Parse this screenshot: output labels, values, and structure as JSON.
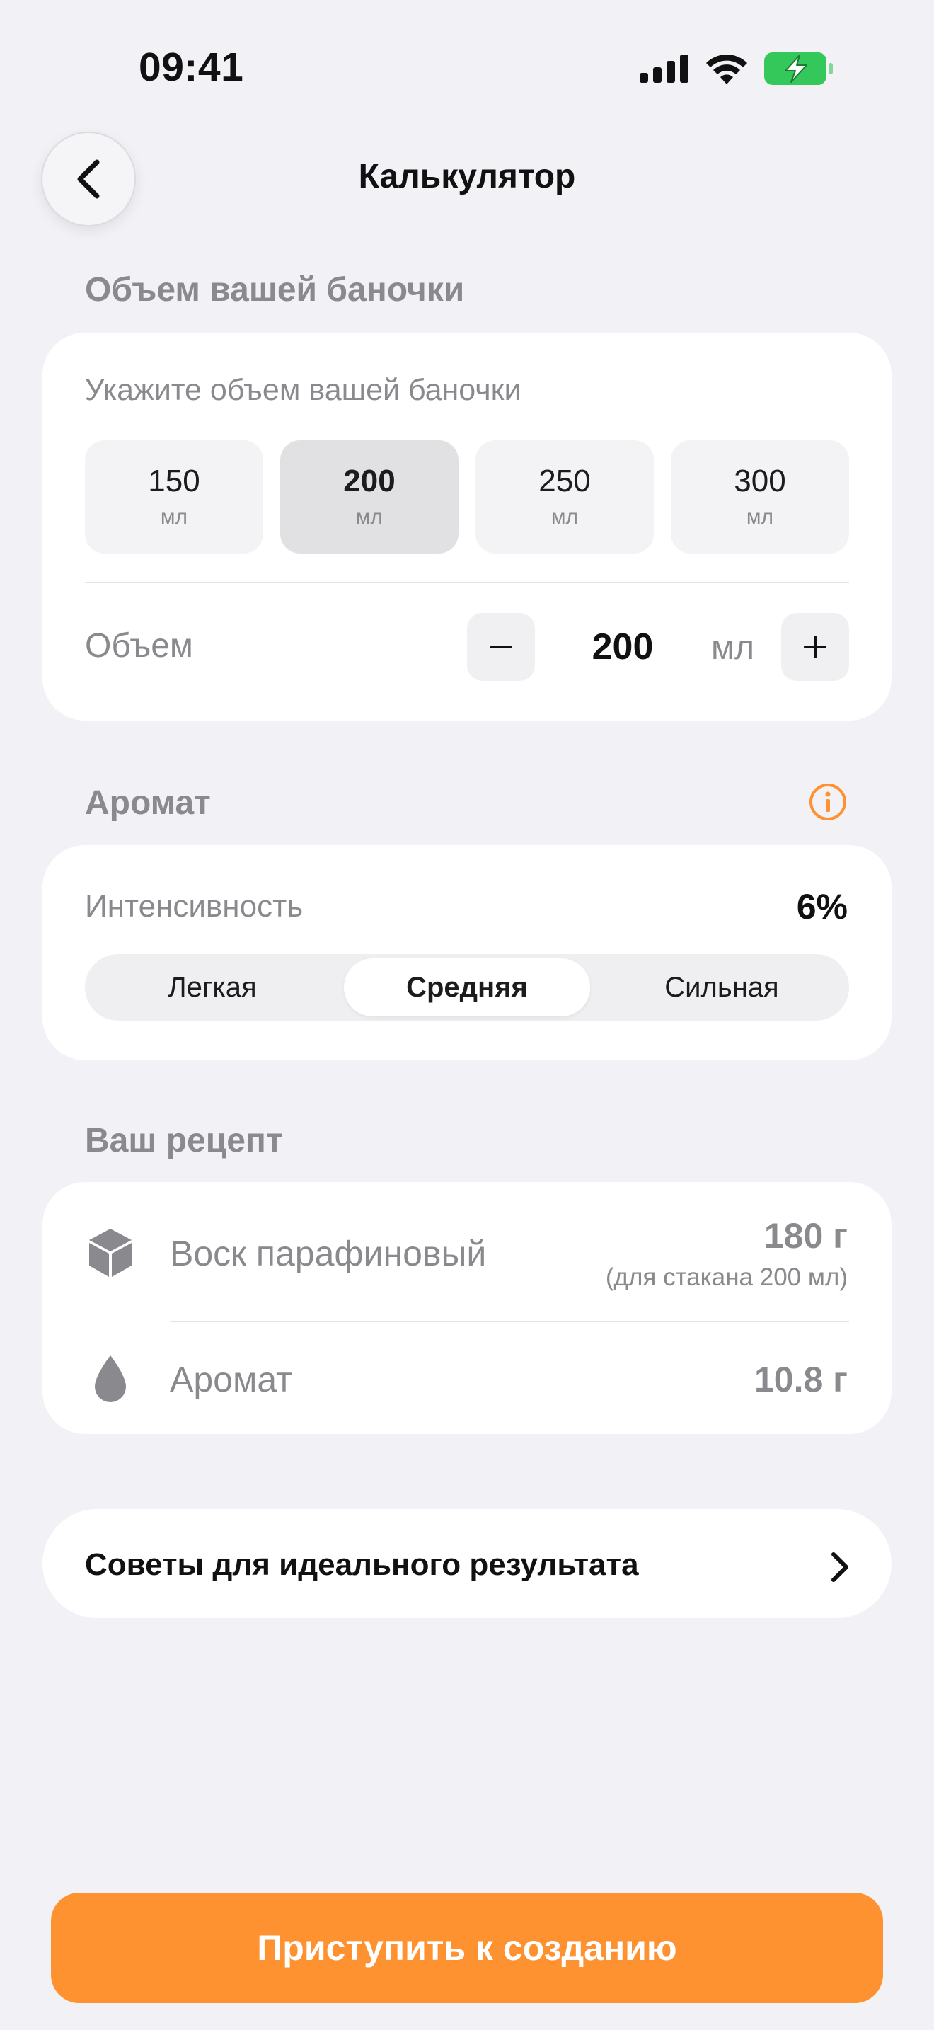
{
  "status_bar": {
    "time": "09:41"
  },
  "header": {
    "title": "Калькулятор",
    "back_icon": "chevron-left-icon"
  },
  "volume_section": {
    "title": "Объем вашей баночки",
    "hint": "Укажите объем вашей баночки",
    "presets": [
      {
        "value": "150",
        "unit": "мл",
        "selected": false
      },
      {
        "value": "200",
        "unit": "мл",
        "selected": true
      },
      {
        "value": "250",
        "unit": "мл",
        "selected": false
      },
      {
        "value": "300",
        "unit": "мл",
        "selected": false
      }
    ],
    "stepper": {
      "label": "Объем",
      "value": "200",
      "unit": "мл",
      "minus": "−",
      "plus": "+"
    }
  },
  "aroma_section": {
    "title": "Аромат",
    "info_icon": "info-icon",
    "accent_color": "#ff9230",
    "intensity_label": "Интенсивность",
    "intensity_value": "6%",
    "segments": [
      {
        "label": "Легкая",
        "selected": false
      },
      {
        "label": "Средняя",
        "selected": true
      },
      {
        "label": "Сильная",
        "selected": false
      }
    ]
  },
  "recipe_section": {
    "title": "Ваш рецепт",
    "items": [
      {
        "icon": "cube-icon",
        "name": "Воск парафиновый",
        "value": "180 г",
        "note": "(для стакана 200 мл)"
      },
      {
        "icon": "drop-icon",
        "name": "Аромат",
        "value": "10.8 г"
      }
    ]
  },
  "tips": {
    "label": "Советы для идеального результата",
    "icon": "chevron-right-icon"
  },
  "cta": {
    "label": "Приступить к созданию",
    "color": "#ff9230"
  }
}
